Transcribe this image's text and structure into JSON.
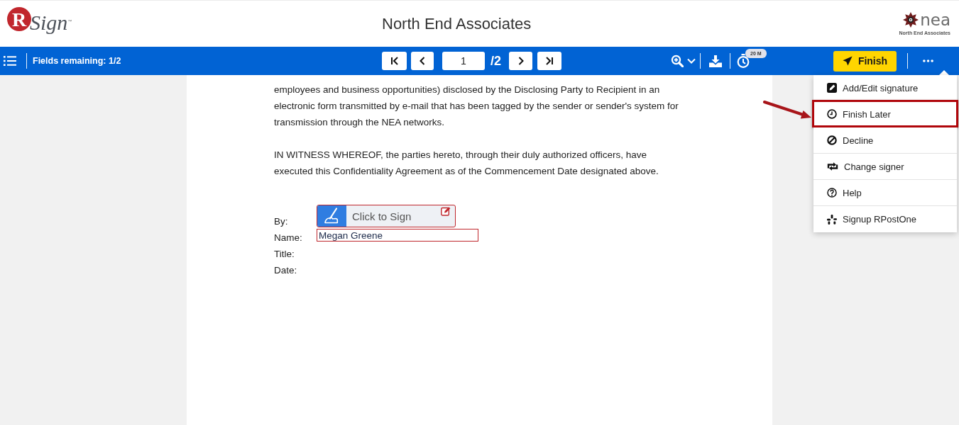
{
  "header": {
    "brand": {
      "mark": "R",
      "name": "Sign",
      "trademark": "™"
    },
    "title": "North End Associates",
    "client_logo": {
      "name": "nea",
      "subtitle": "North End Associates"
    }
  },
  "toolbar": {
    "fields_remaining": "Fields remaining: 1/2",
    "pager": {
      "current": "1",
      "total": "/2"
    },
    "timer_badge": "20 M",
    "finish_button": "Finish"
  },
  "menu": {
    "open": true,
    "items": [
      {
        "kind": "edit",
        "label": "Add/Edit signature",
        "highlighted": false
      },
      {
        "kind": "clock",
        "label": "Finish Later",
        "highlighted": true
      },
      {
        "kind": "ban",
        "label": "Decline",
        "highlighted": false
      },
      {
        "kind": "swap",
        "label": "Change signer",
        "highlighted": false
      },
      {
        "kind": "help",
        "label": "Help",
        "highlighted": false
      },
      {
        "kind": "burst",
        "label": "Signup RPostOne",
        "highlighted": false
      }
    ]
  },
  "document": {
    "paragraphs": [
      "employees and business opportunities) disclosed by the Disclosing Party to Recipient in an electronic form transmitted by e-mail that has been tagged by the sender or sender's system for transmission through the NEA networks.",
      "IN WITNESS WHEREOF, the parties hereto, through their duly authorized officers, have executed this Confidentiality Agreement as of the Commencement Date designated above."
    ],
    "signature_block": {
      "labels": [
        "By:",
        "Name:",
        "Title:",
        "Date:"
      ],
      "sign_field": {
        "label": "Click to Sign",
        "required": true
      },
      "name_field": {
        "value": "Megan Greene",
        "required": true
      }
    }
  }
}
